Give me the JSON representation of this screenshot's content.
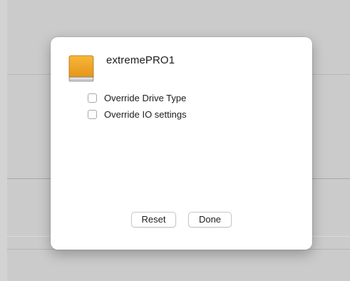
{
  "dialog": {
    "drive_icon": "external-drive-icon",
    "drive_name": "extremePRO1",
    "options": [
      {
        "label": "Override Drive Type",
        "checked": false
      },
      {
        "label": "Override IO settings",
        "checked": false
      }
    ],
    "buttons": {
      "reset_label": "Reset",
      "done_label": "Done"
    }
  },
  "colors": {
    "drive_orange": "#f0a020",
    "backdrop": "#cbcbcb"
  }
}
